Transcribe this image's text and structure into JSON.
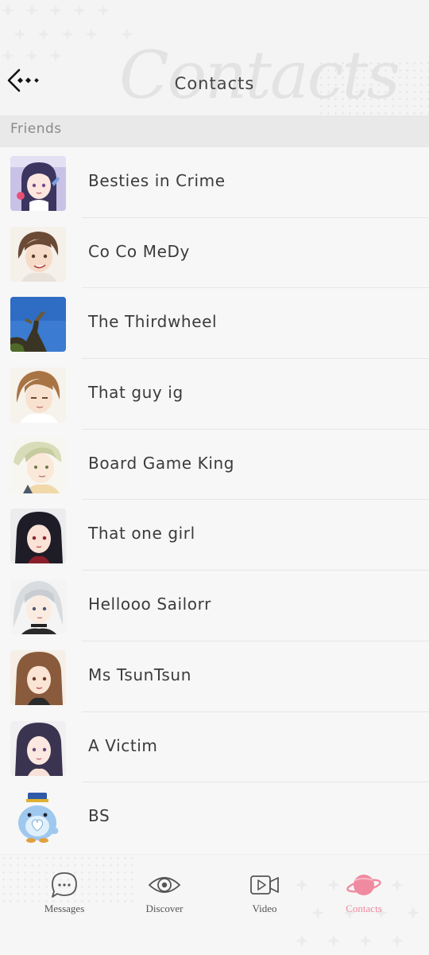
{
  "header": {
    "title": "Contacts",
    "watermark": "Contacts"
  },
  "section": {
    "label": "Friends"
  },
  "contacts": [
    {
      "name": "Besties in Crime",
      "avatar": "group-chat-avatar"
    },
    {
      "name": "Co Co MeDy",
      "avatar": "brown-haired-man-avatar"
    },
    {
      "name": "The Thirdwheel",
      "avatar": "statue-sky-avatar"
    },
    {
      "name": "That guy ig",
      "avatar": "light-brown-haired-man-avatar"
    },
    {
      "name": "Board Game King",
      "avatar": "blonde-man-avatar"
    },
    {
      "name": "That one girl",
      "avatar": "black-haired-girl-avatar"
    },
    {
      "name": "Hellooo Sailorr",
      "avatar": "silver-haired-girl-avatar"
    },
    {
      "name": "Ms TsunTsun",
      "avatar": "brown-haired-girl-avatar"
    },
    {
      "name": "A Victim",
      "avatar": "dark-haired-girl-avatar"
    },
    {
      "name": "BS",
      "avatar": "blue-bird-mascot-avatar"
    }
  ],
  "tabs": [
    {
      "label": "Messages",
      "icon": "chat-bubble-icon",
      "active": false
    },
    {
      "label": "Discover",
      "icon": "eye-icon",
      "active": false
    },
    {
      "label": "Video",
      "icon": "video-camera-icon",
      "active": false
    },
    {
      "label": "Contacts",
      "icon": "planet-icon",
      "active": true
    }
  ],
  "colors": {
    "accent": "#f08aa0",
    "section_bg": "#e9e9e9",
    "background": "#f7f7f7"
  }
}
